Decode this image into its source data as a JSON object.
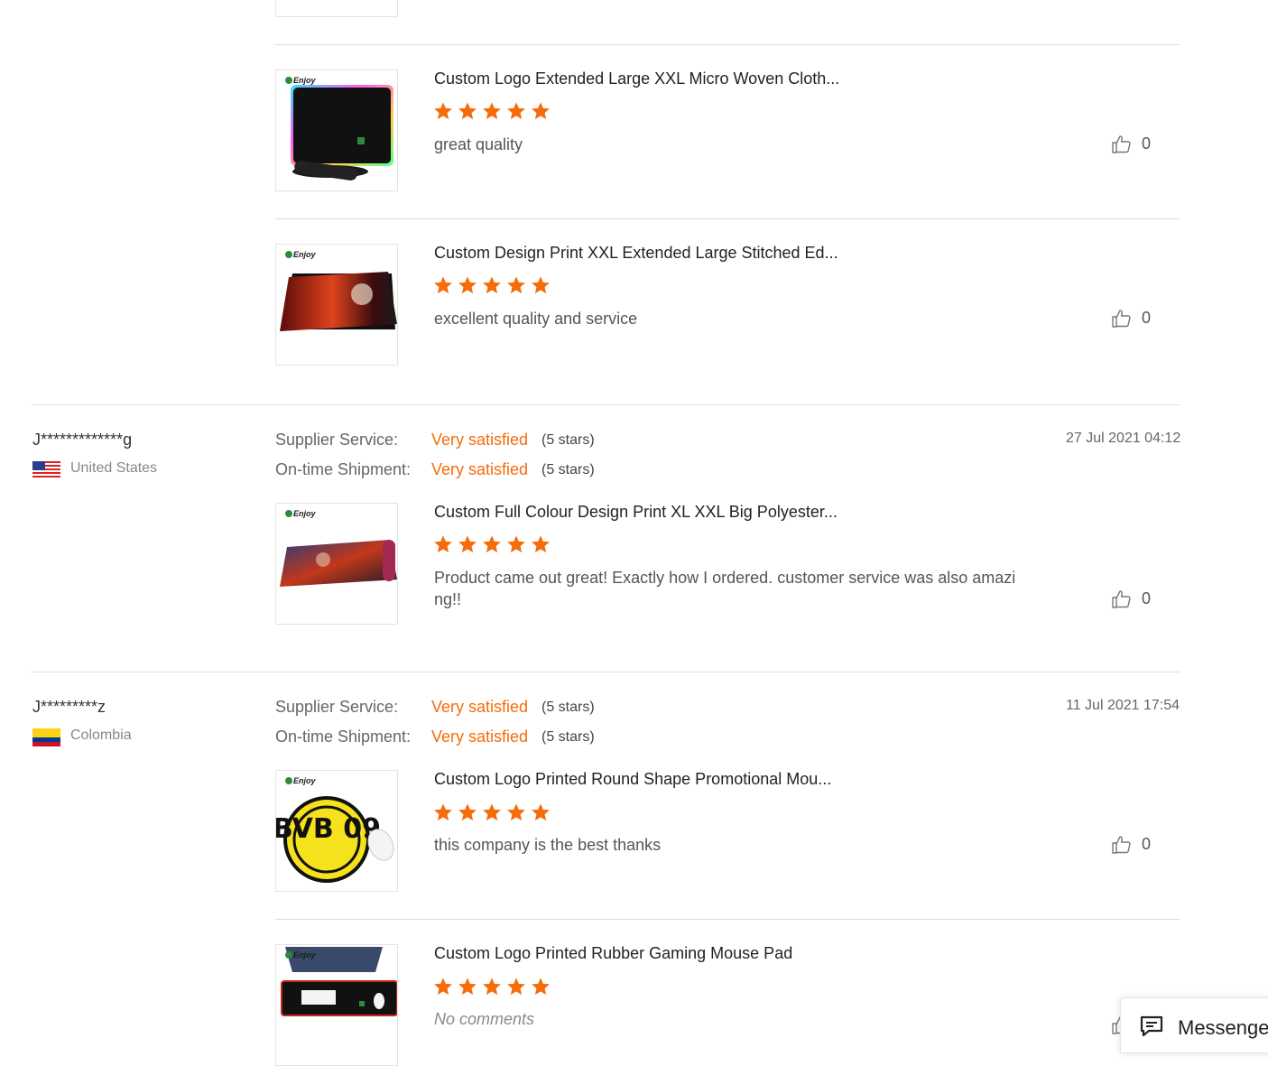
{
  "colors": {
    "accent": "#f56c0b",
    "star": "#f56c0b",
    "divider": "#dcdcdc"
  },
  "top_partial_thumb": {
    "alt": ""
  },
  "reviews_group_1": {
    "products": [
      {
        "brand": "Enjoy",
        "title": "Custom Logo Extended Large XXL Micro Woven Cloth...",
        "rating": 5,
        "comment": "great quality",
        "likes": "0",
        "image_desc": "rgb-black-mouse-pad"
      },
      {
        "brand": "Enjoy",
        "title": "Custom Design Print XXL Extended Large Stitched Ed...",
        "rating": 5,
        "comment": "excellent quality and service",
        "likes": "0",
        "image_desc": "red-art-mouse-pad"
      }
    ]
  },
  "review_2": {
    "username": "J*************g",
    "country": "United States",
    "flag": "us-flag",
    "date": "27 Jul 2021 04:12",
    "supplier_service_label": "Supplier Service:",
    "supplier_service_value": "Very satisfied",
    "supplier_service_stars": "(5 stars)",
    "shipment_label": "On-time Shipment:",
    "shipment_value": "Very satisfied",
    "shipment_stars": "(5 stars)",
    "product": {
      "brand": "Enjoy",
      "title": "Custom Full Colour Design Print XL XXL Big Polyester...",
      "rating": 5,
      "comment_line1": "Product came out great! Exactly how I ordered. customer service was also amazi",
      "comment_line2": "ng!!",
      "likes": "0"
    }
  },
  "review_3": {
    "username": "J*********z",
    "country": "Colombia",
    "flag": "colombia-flag",
    "date": "11 Jul 2021 17:54",
    "supplier_service_label": "Supplier Service:",
    "supplier_service_value": "Very satisfied",
    "supplier_service_stars": "(5 stars)",
    "shipment_label": "On-time Shipment:",
    "shipment_value": "Very satisfied",
    "shipment_stars": "(5 stars)",
    "products": [
      {
        "brand": "Enjoy",
        "title": "Custom Logo Printed Round Shape Promotional Mou...",
        "rating": 5,
        "comment": "this company is the best thanks",
        "likes": "0",
        "image_text": "BVB 09"
      },
      {
        "brand": "Enjoy",
        "title": "Custom Logo Printed Rubber Gaming Mouse Pad",
        "rating": 5,
        "comment": "No comments",
        "likes": ""
      }
    ]
  },
  "messenger": {
    "label": "Messenger",
    "icon": "chat-icon"
  }
}
